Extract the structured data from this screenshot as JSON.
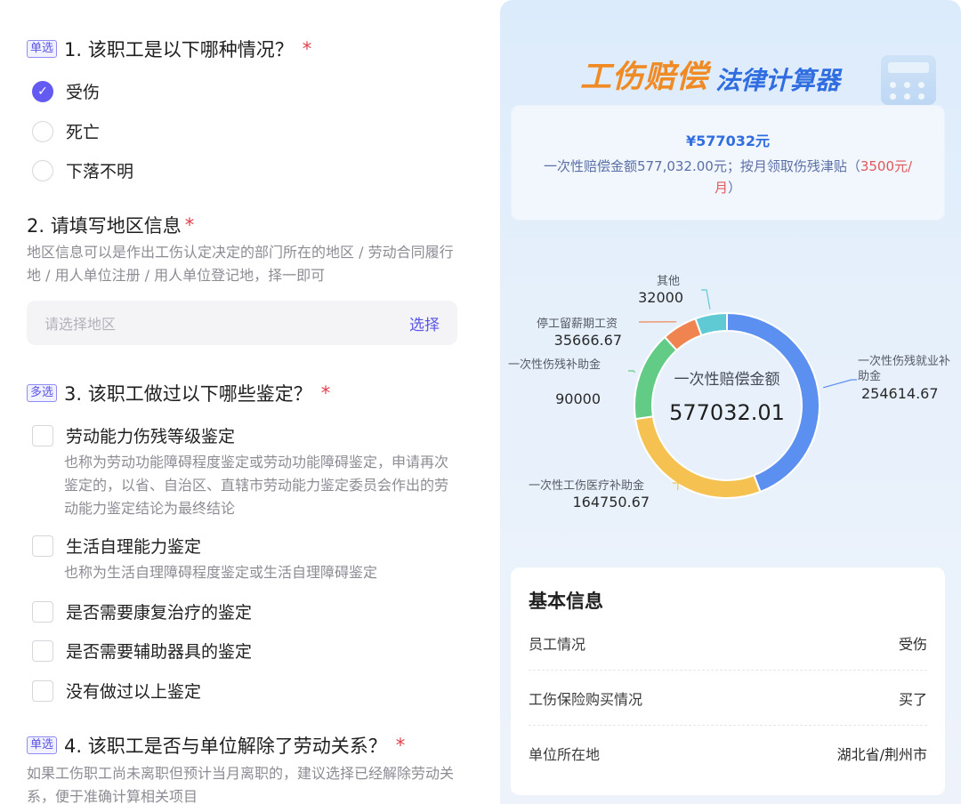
{
  "form": {
    "q1": {
      "tag": "单选",
      "title": "1. 该职工是以下哪种情况？",
      "required": "*",
      "options": [
        {
          "label": "受伤",
          "checked": true
        },
        {
          "label": "死亡",
          "checked": false
        },
        {
          "label": "下落不明",
          "checked": false
        }
      ]
    },
    "q2": {
      "title": "2. 请填写地区信息",
      "required": "*",
      "hint": "地区信息可以是作出工伤认定决定的部门所在的地区 / 劳动合同履行地 / 用人单位注册 / 用人单位登记地，择一即可",
      "placeholder": "请选择地区",
      "select_label": "选择"
    },
    "q3": {
      "tag": "多选",
      "title": "3. 该职工做过以下哪些鉴定？",
      "required": "*",
      "options": [
        {
          "label": "劳动能力伤残等级鉴定",
          "sub": "也称为劳动功能障碍程度鉴定或劳动功能障碍鉴定，申请再次鉴定的，以省、自治区、直辖市劳动能力鉴定委员会作出的劳动能力鉴定结论为最终结论"
        },
        {
          "label": "生活自理能力鉴定",
          "sub": "也称为生活自理障碍程度鉴定或生活自理障碍鉴定"
        },
        {
          "label": "是否需要康复治疗的鉴定",
          "sub": ""
        },
        {
          "label": "是否需要辅助器具的鉴定",
          "sub": ""
        },
        {
          "label": "没有做过以上鉴定",
          "sub": ""
        }
      ]
    },
    "q4": {
      "tag": "单选",
      "title": "4. 该职工是否与单位解除了劳动关系？",
      "required": "*",
      "hint": "如果工伤职工尚未离职但预计当月离职的，建议选择已经解除劳动关系，便于准确计算相关项目"
    }
  },
  "result": {
    "hero_orange": "工伤赔偿",
    "hero_blue": "法律计算器",
    "amount": "¥577032元",
    "desc_main": "一次性赔偿金额577,032.00元；按月领取伤残津贴（",
    "desc_highlight": "3500元/月",
    "desc_end": "）"
  },
  "chart_data": {
    "type": "pie",
    "center_label": "一次性赔偿金额",
    "center_value": "577032.01",
    "slices": [
      {
        "name": "一次性伤残就业补助金",
        "value": 254614.67,
        "value_label": "254614.67",
        "color": "#5b8ff0"
      },
      {
        "name": "一次性工伤医疗补助金",
        "value": 164750.67,
        "value_label": "164750.67",
        "color": "#f5c150"
      },
      {
        "name": "一次性伤残补助金",
        "value": 90000,
        "value_label": "90000",
        "color": "#62cc86"
      },
      {
        "name": "停工留薪期工资",
        "value": 35666.67,
        "value_label": "35666.67",
        "color": "#f08450"
      },
      {
        "name": "其他",
        "value": 32000,
        "value_label": "32000",
        "color": "#5fc9d4"
      }
    ]
  },
  "info": {
    "title": "基本信息",
    "rows": [
      {
        "label": "员工情况",
        "value": "受伤"
      },
      {
        "label": "工伤保险购买情况",
        "value": "买了"
      },
      {
        "label": "单位所在地",
        "value": "湖北省/荆州市"
      }
    ]
  }
}
